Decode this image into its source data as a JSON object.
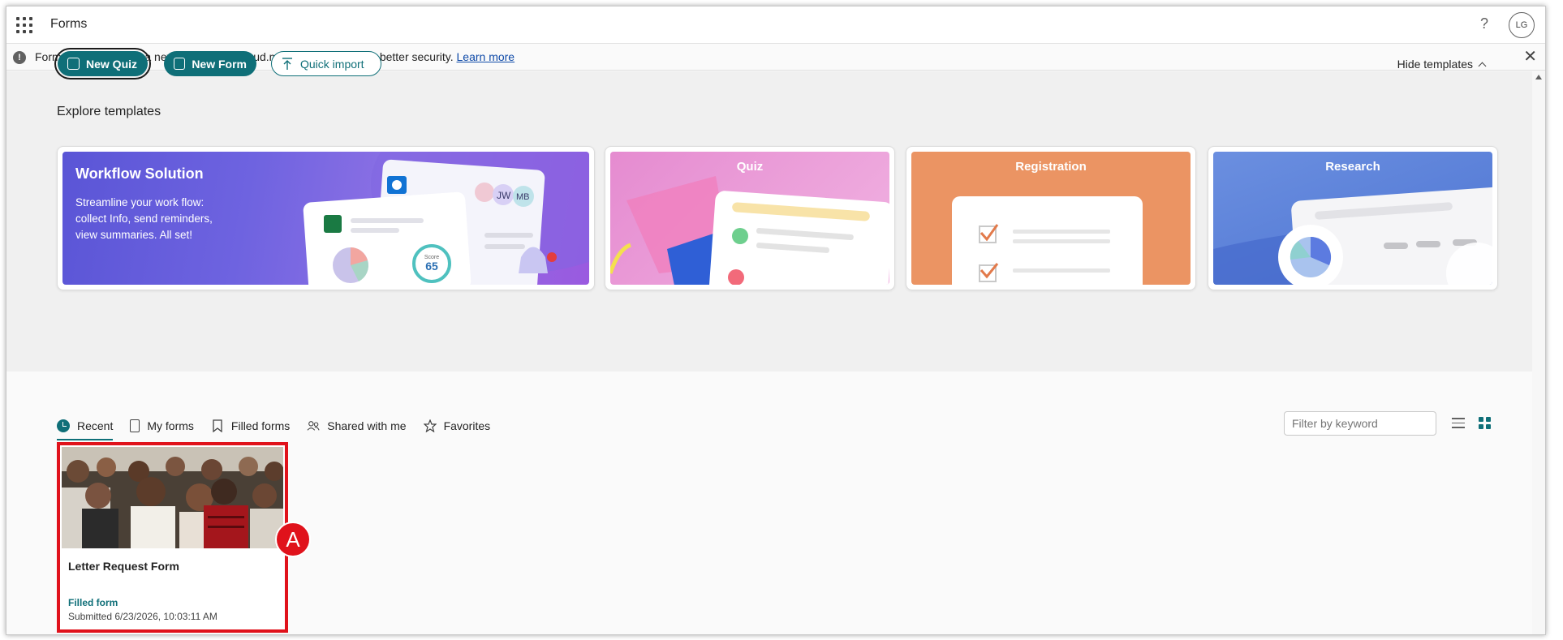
{
  "app": {
    "title": "Forms",
    "help_glyph": "?",
    "avatar_initials": "LG"
  },
  "banner": {
    "message": "Forms will soon have a new URL: forms.cloud.microsoft. Same app, better security.",
    "link": "Learn more",
    "close_glyph": "✕",
    "info_glyph": "!"
  },
  "actions": {
    "new_quiz": "New Quiz",
    "new_form": "New Form",
    "quick_import": "Quick import",
    "hide_templates": "Hide templates"
  },
  "templates": {
    "heading": "Explore templates",
    "items": [
      {
        "title": "Workflow Solution",
        "description": "Streamline your work flow: collect Info, send reminders, view summaries. All set!",
        "score_label": "Score",
        "score_value": "65",
        "avatar_a": "JW",
        "avatar_b": "MB"
      },
      {
        "title": "Quiz"
      },
      {
        "title": "Registration"
      },
      {
        "title": "Research"
      }
    ]
  },
  "tabs": [
    {
      "label": "Recent",
      "active": true,
      "icon": "clock-icon"
    },
    {
      "label": "My forms",
      "active": false,
      "icon": "document-icon"
    },
    {
      "label": "Filled forms",
      "active": false,
      "icon": "bookmark-icon"
    },
    {
      "label": "Shared with me",
      "active": false,
      "icon": "people-icon"
    },
    {
      "label": "Favorites",
      "active": false,
      "icon": "star-icon"
    }
  ],
  "filter": {
    "placeholder": "Filter by keyword"
  },
  "forms": [
    {
      "title": "Letter Request Form",
      "status": "Filled form",
      "submitted": "Submitted 6/23/2026, 10:03:11 AM"
    }
  ],
  "marker": {
    "label": "A"
  },
  "colors": {
    "accent": "#0f6f78",
    "highlight": "#e0121b",
    "link": "#0f4aa8"
  }
}
